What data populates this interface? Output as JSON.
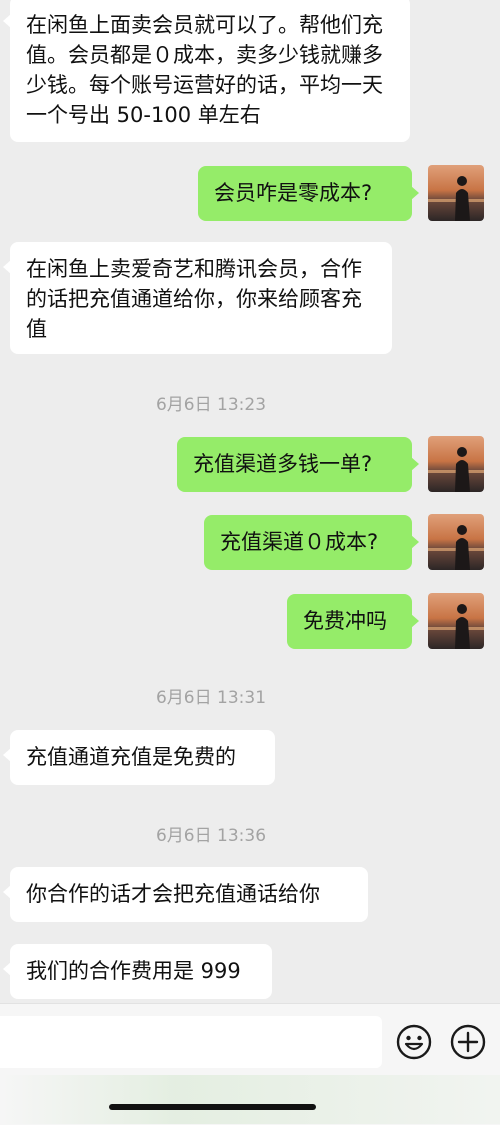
{
  "messages": [
    {
      "side": "left",
      "text": "在闲鱼上面卖会员就可以了。帮他们充值。会员都是０成本，卖多少钱就赚多少钱。每个账号运营好的话，平均一天一个号出 50-100 单左右"
    },
    {
      "side": "right",
      "text": "会员咋是零成本?"
    },
    {
      "side": "left",
      "text": "在闲鱼上卖爱奇艺和腾讯会员，合作的话把充值通道给你，你来给顾客充值"
    },
    {
      "side": "time",
      "text": "6月6日 13:23"
    },
    {
      "side": "right",
      "text": "充值渠道多钱一单?"
    },
    {
      "side": "right",
      "text": "充值渠道０成本?"
    },
    {
      "side": "right",
      "text": "免费冲吗"
    },
    {
      "side": "time",
      "text": "6月6日 13:31"
    },
    {
      "side": "left",
      "text": "充值通道充值是免费的"
    },
    {
      "side": "time",
      "text": "6月6日 13:36"
    },
    {
      "side": "left",
      "text": "你合作的话才会把充值通话给你"
    },
    {
      "side": "left",
      "text": "我们的合作费用是 999"
    }
  ],
  "input": {
    "value": ""
  },
  "icons": {
    "emoji": "emoji-icon",
    "plus": "plus-icon"
  },
  "colors": {
    "background": "#ededed",
    "left_bubble": "#ffffff",
    "right_bubble": "#95ec69",
    "timestamp": "#a3a3a3"
  }
}
